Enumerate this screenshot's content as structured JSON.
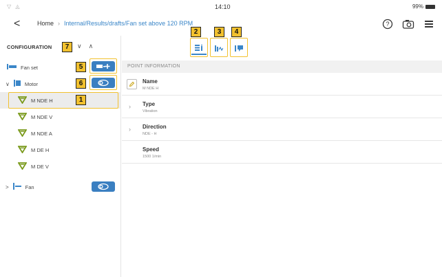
{
  "status": {
    "left_icons": "▽ ◬",
    "time": "14:10",
    "battery": "99%"
  },
  "nav": {
    "back_glyph": "<",
    "home": "Home",
    "separator": "›",
    "path": "Internal/Results/drafts/Fan set above 120 RPM",
    "icons": [
      "help-icon",
      "camera-icon",
      "menu-icon"
    ]
  },
  "config": {
    "heading": "CONFIGURATION",
    "collapse_down": "∨",
    "collapse_up": "∧",
    "tree": [
      {
        "label": "Fan set",
        "icon": "fan-set-icon"
      },
      {
        "label": "Motor",
        "icon": "motor-icon",
        "expander": "∨"
      },
      {
        "label": "M NDE H",
        "icon": "sensor-icon",
        "selected": true
      },
      {
        "label": "M NDE V",
        "icon": "sensor-icon"
      },
      {
        "label": "M NDE A",
        "icon": "sensor-icon"
      },
      {
        "label": "M DE H",
        "icon": "sensor-icon"
      },
      {
        "label": "M DE V",
        "icon": "sensor-icon"
      },
      {
        "label": "Fan",
        "icon": "fan-icon",
        "expander": ">"
      }
    ]
  },
  "callouts": [
    "1",
    "2",
    "3",
    "4",
    "5",
    "6",
    "7"
  ],
  "point_info": {
    "section_label": "POINT INFORMATION",
    "rows": [
      {
        "title": "Name",
        "value": "M NDE H"
      },
      {
        "title": "Type",
        "value": "Vibration"
      },
      {
        "title": "Direction",
        "value": "NDE - H"
      },
      {
        "title": "Speed",
        "value": "1500 1/min"
      }
    ]
  },
  "colors": {
    "accent": "#3a86c8",
    "button_blue": "#3a7fc1",
    "callout_yellow": "#f2c12e"
  }
}
